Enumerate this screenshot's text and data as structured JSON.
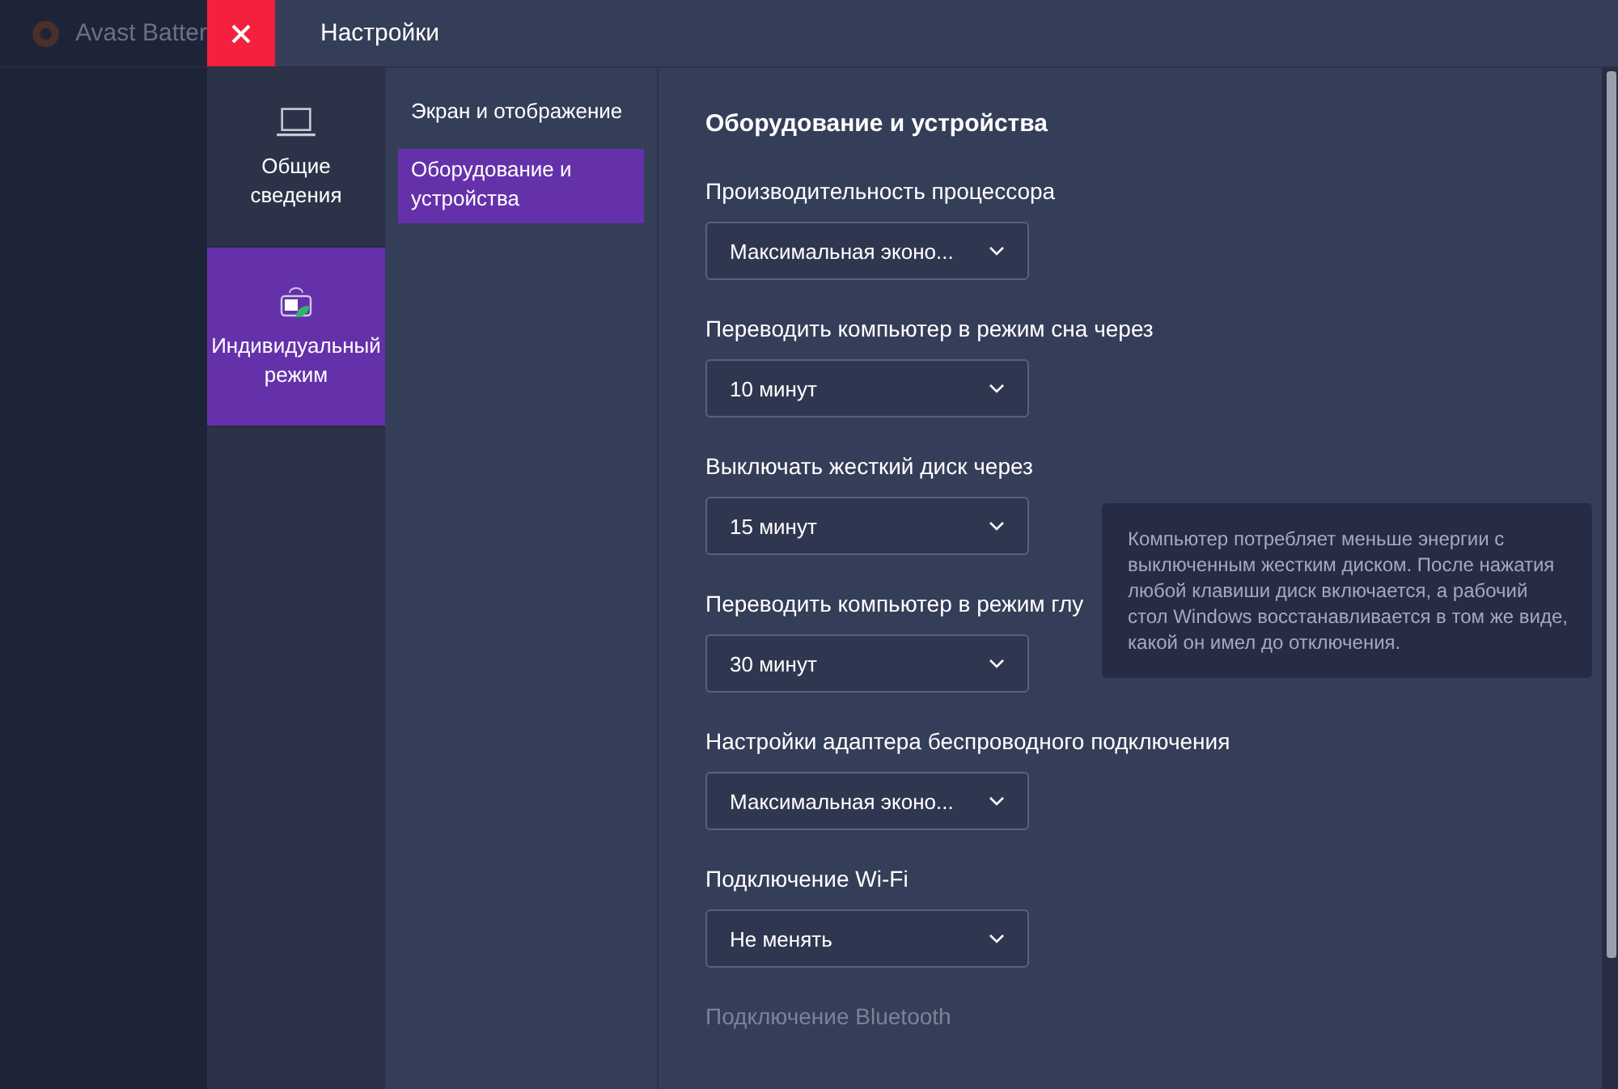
{
  "background_app": {
    "title": "Avast Batter"
  },
  "window": {
    "title": "Настройки"
  },
  "nav": [
    {
      "label": "Общие сведения",
      "selected": false
    },
    {
      "label": "Индивидуальный режим",
      "selected": true
    }
  ],
  "subnav": [
    {
      "label": "Экран и отображение",
      "selected": false
    },
    {
      "label": "Оборудование и устройства",
      "selected": true
    }
  ],
  "content": {
    "heading": "Оборудование и устройства",
    "settings": [
      {
        "label": "Производительность процессора",
        "value": "Максимальная эконо..."
      },
      {
        "label": "Переводить компьютер в режим сна через",
        "value": "10 минут"
      },
      {
        "label": "Выключать жесткий диск через",
        "value": "15 минут"
      },
      {
        "label": "Переводить компьютер в режим глу",
        "value": "30 минут"
      },
      {
        "label": "Настройки адаптера беспроводного подключения",
        "value": "Максимальная эконо..."
      },
      {
        "label": "Подключение Wi-Fi",
        "value": "Не менять"
      },
      {
        "label": "Подключение Bluetooth"
      }
    ]
  },
  "tooltip": "Компьютер потребляет меньше энергии с выключенным жестким диском. После нажатия любой клавиши диск включается, а рабочий стол Windows восстанавливается в том же виде, какой он имел до отключения."
}
